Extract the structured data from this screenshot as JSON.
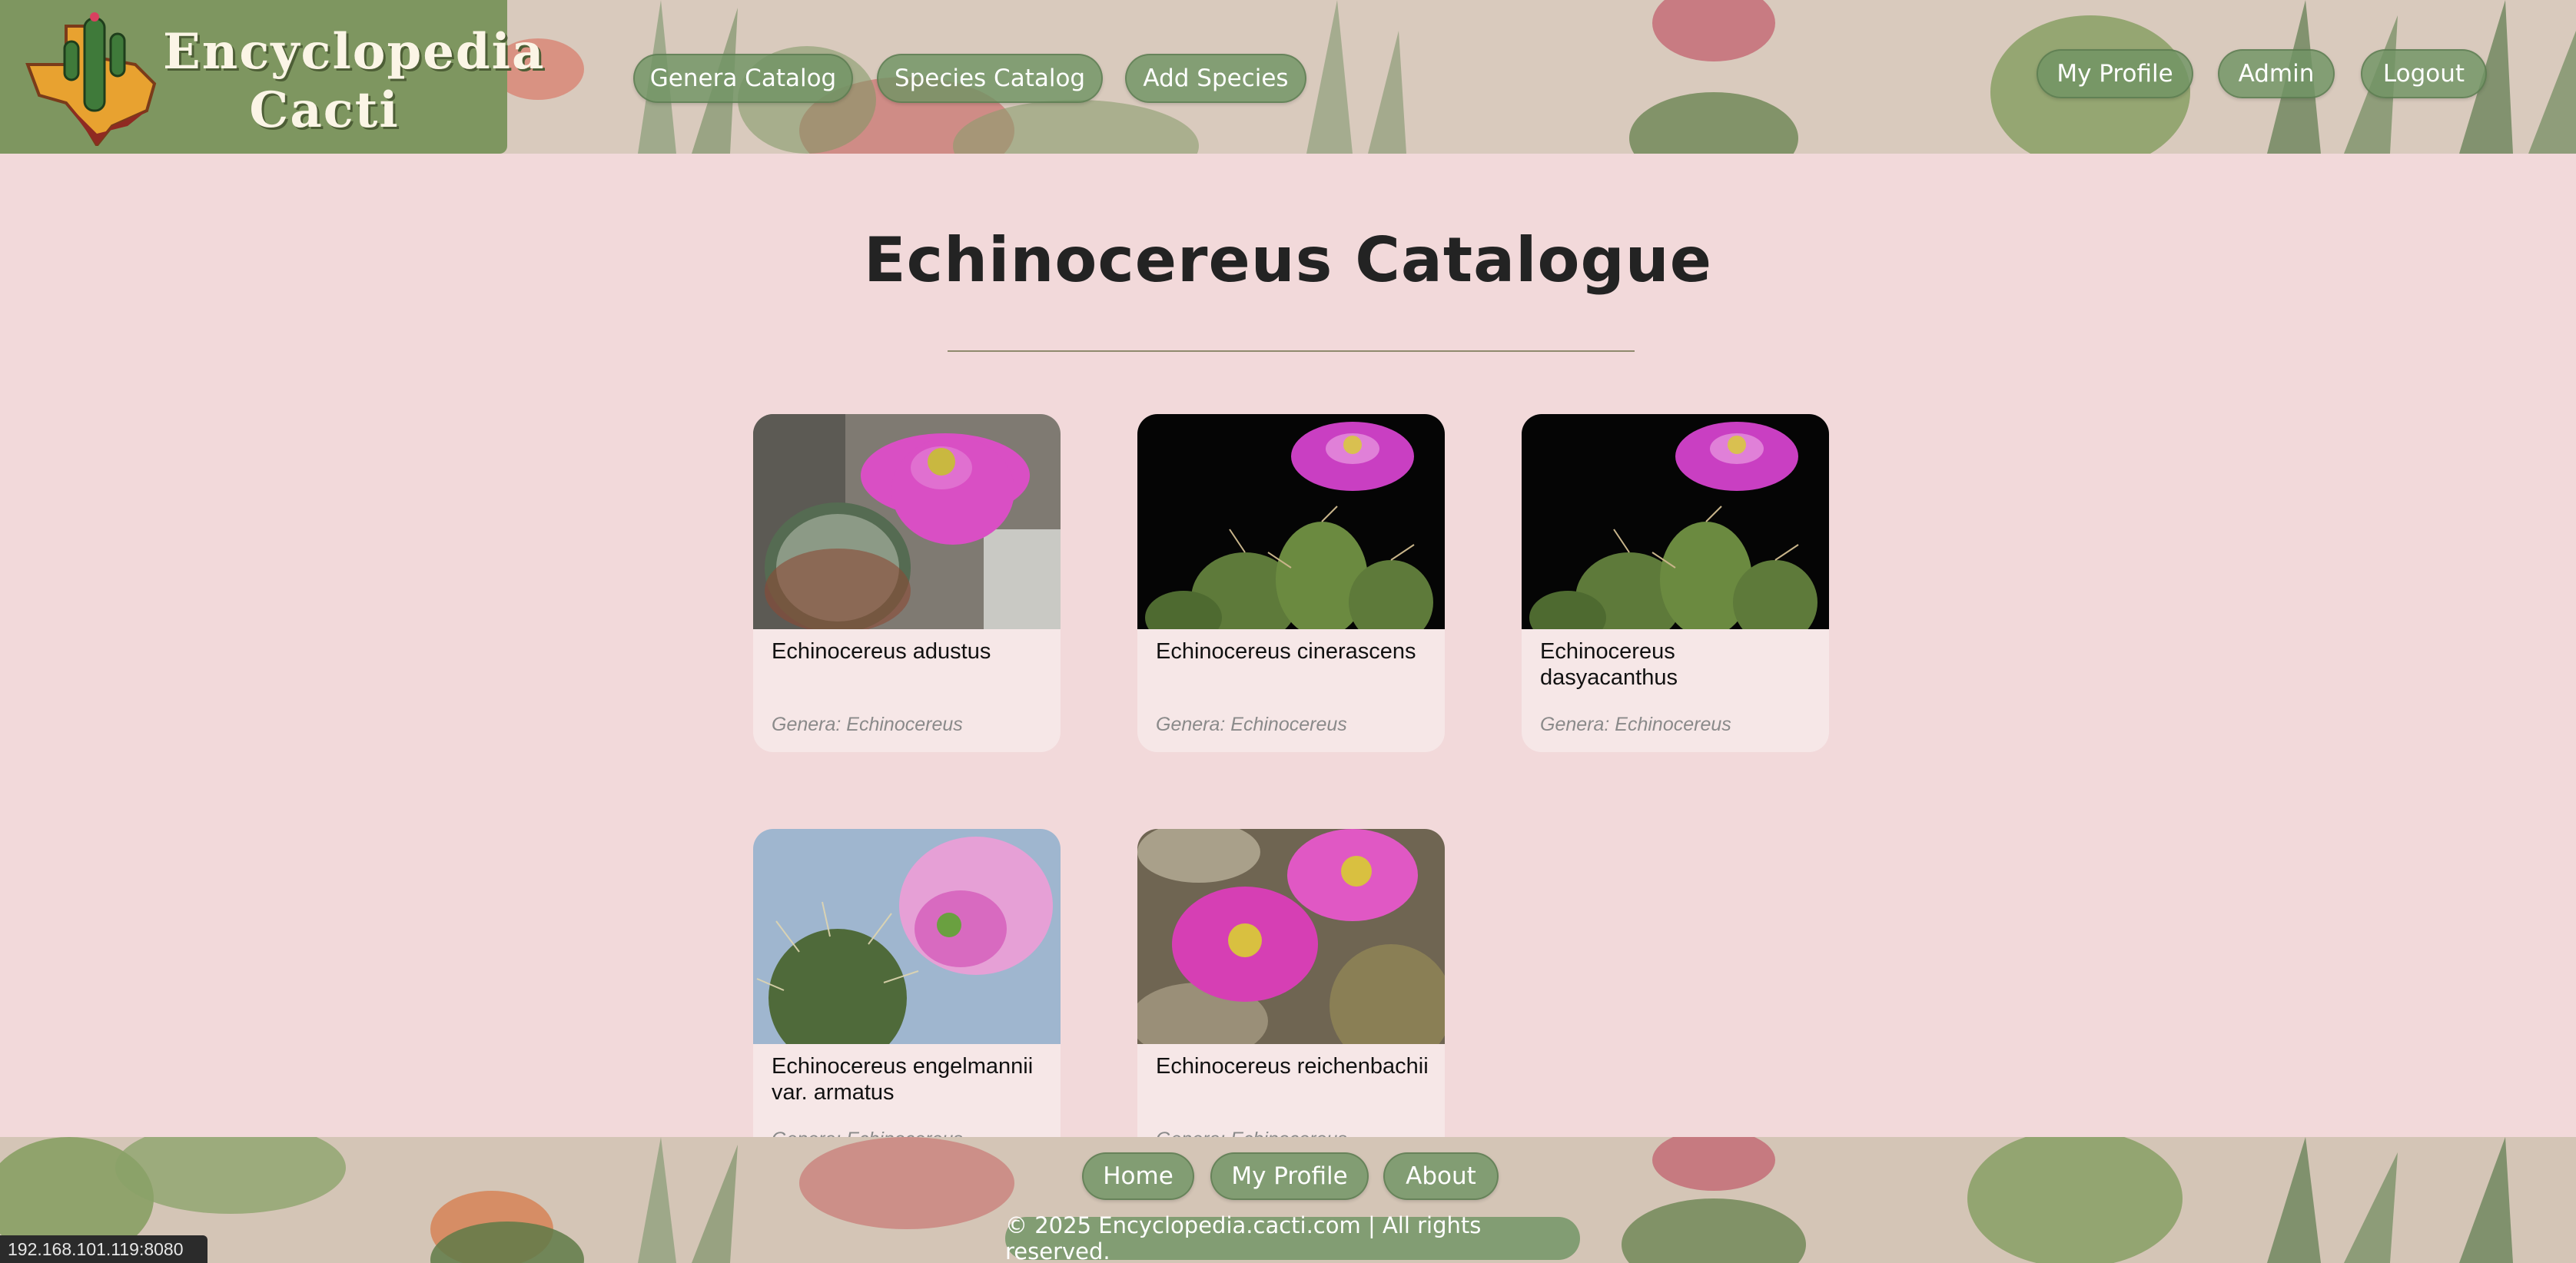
{
  "header": {
    "logo_text": "Encyclopedia Cacti",
    "logo_line1": "Encyclopedia",
    "logo_line2": "Cacti",
    "nav_left": [
      "Genera Catalog",
      "Species Catalog",
      "Add Species"
    ],
    "nav_right": [
      "My Profile",
      "Admin",
      "Logout"
    ]
  },
  "main": {
    "title": "Echinocereus Catalogue",
    "cards": [
      {
        "name": "Echinocereus adustus",
        "genus": "Genera: Echinocereus"
      },
      {
        "name": "Echinocereus cinerascens",
        "genus": "Genera: Echinocereus"
      },
      {
        "name": "Echinocereus dasyacanthus",
        "genus": "Genera: Echinocereus"
      },
      {
        "name": "Echinocereus engelmannii var. armatus",
        "genus": "Genera: Echinocereus"
      },
      {
        "name": "Echinocereus reichenbachii",
        "genus": "Genera: Echinocereus"
      }
    ]
  },
  "footer": {
    "links": [
      "Home",
      "My Profile",
      "About"
    ],
    "copyright": "© 2025 Encyclopedia.cacti.com | All rights reserved."
  },
  "status_bar": {
    "url": "192.168.101.119:8080"
  },
  "colors": {
    "page_bg": "#f2d9da",
    "card_bg": "#f6e7e7",
    "pill_green": "#709464",
    "logo_green": "#7e9660"
  }
}
